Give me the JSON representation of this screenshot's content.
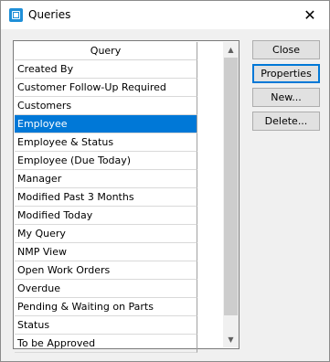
{
  "window": {
    "title": "Queries"
  },
  "list": {
    "column_header": "Query",
    "items": [
      "Created By",
      "Customer Follow-Up Required",
      "Customers",
      "Employee",
      "Employee & Status",
      "Employee (Due Today)",
      "Manager",
      "Modified Past 3 Months",
      "Modified Today",
      "My Query",
      "NMP View",
      "Open Work Orders",
      "Overdue",
      "Pending & Waiting on Parts",
      "Status",
      "To be Approved"
    ],
    "selected": "Employee"
  },
  "buttons": {
    "close": "Close",
    "properties": "Properties",
    "new": "New...",
    "delete": "Delete..."
  },
  "colors": {
    "selection": "#0078d7"
  }
}
